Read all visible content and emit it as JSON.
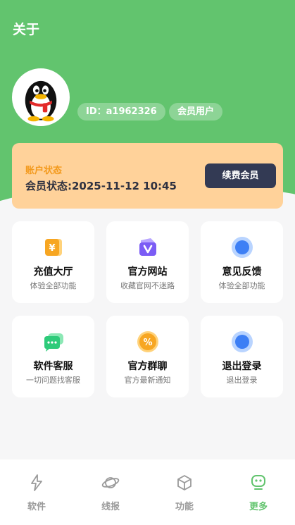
{
  "header": {
    "title": "关于"
  },
  "profile": {
    "id_label": "ID：a1962326",
    "member_badge": "会员用户"
  },
  "account": {
    "label": "账户状态",
    "status": "会员状态:2025-11-12 10:45",
    "renew_button": "续费会员"
  },
  "features": [
    {
      "name": "充值大厅",
      "desc": "体验全部功能",
      "icon": "recharge-icon"
    },
    {
      "name": "官方网站",
      "desc": "收藏官网不迷路",
      "icon": "website-icon"
    },
    {
      "name": "意见反馈",
      "desc": "体验全部功能",
      "icon": "feedback-icon"
    },
    {
      "name": "软件客服",
      "desc": "一切问题找客服",
      "icon": "chat-icon"
    },
    {
      "name": "官方群聊",
      "desc": "官方最新通知",
      "icon": "group-chat-icon"
    },
    {
      "name": "退出登录",
      "desc": "退出登录",
      "icon": "logout-icon"
    }
  ],
  "tabbar": {
    "items": [
      {
        "label": "软件",
        "icon": "lightning-icon",
        "active": false
      },
      {
        "label": "线报",
        "icon": "planet-icon",
        "active": false
      },
      {
        "label": "功能",
        "icon": "cube-icon",
        "active": false
      },
      {
        "label": "更多",
        "icon": "robot-icon",
        "active": true
      }
    ]
  },
  "colors": {
    "brand_green": "#62c46e",
    "status_card": "#ffd29a",
    "status_label": "#f39a1d",
    "renew_button": "#333a54"
  }
}
